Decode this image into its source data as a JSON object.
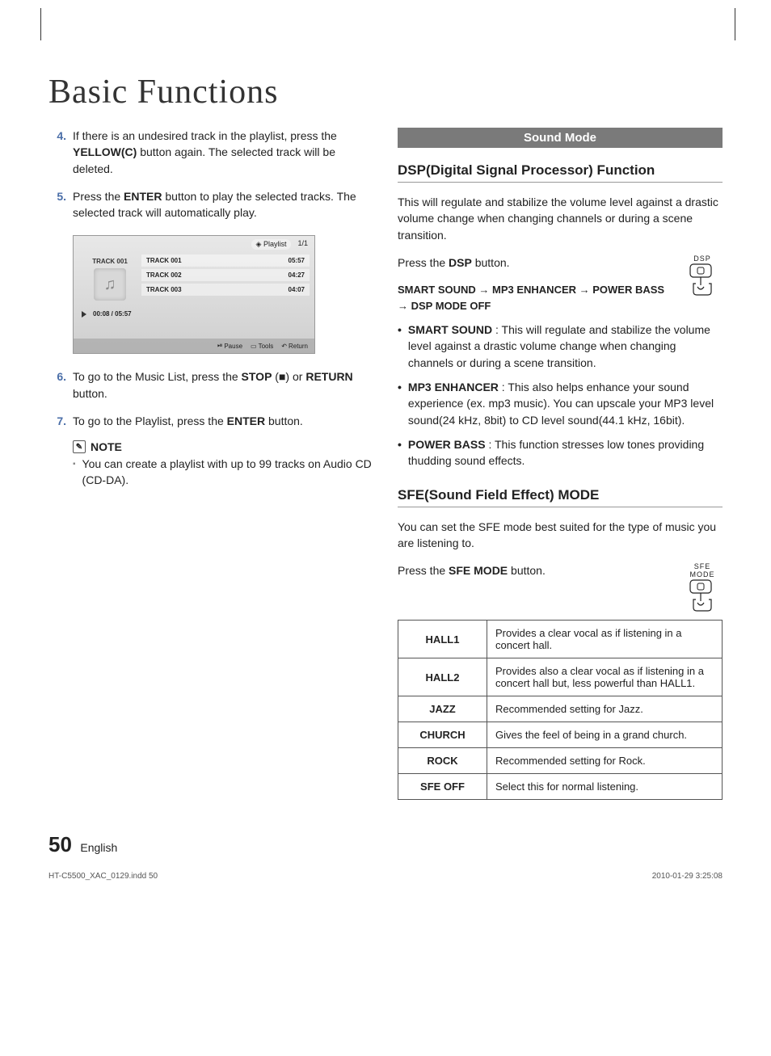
{
  "title": "Basic Functions",
  "steps": [
    {
      "n": "4.",
      "html": "If there is an undesired track in the playlist, press the <b>YELLOW(C)</b> button again. The selected track will be deleted."
    },
    {
      "n": "5.",
      "html": "Press the <b>ENTER</b> button to play the selected tracks. The selected track will automatically play."
    }
  ],
  "screenshot": {
    "headerLeft": "Playlist",
    "headerRight": "1/1",
    "currentCaption": "TRACK 001",
    "tracks": [
      {
        "name": "TRACK 001",
        "time": "05:57"
      },
      {
        "name": "TRACK 002",
        "time": "04:27"
      },
      {
        "name": "TRACK 003",
        "time": "04:07"
      }
    ],
    "progress": "00:08 / 05:57",
    "footer": {
      "pause": "Pause",
      "tools": "Tools",
      "return": "Return"
    }
  },
  "steps2": [
    {
      "n": "6.",
      "html": "To go to the Music List, press the <b>STOP</b> (■) or <b>RETURN</b> button."
    },
    {
      "n": "7.",
      "html": "To go to the Playlist, press the <b>ENTER</b> button."
    }
  ],
  "noteLabel": "NOTE",
  "noteItems": [
    "You can create a playlist with up to 99 tracks on Audio CD (CD-DA)."
  ],
  "soundMode": {
    "bar": "Sound Mode",
    "dspTitle": "DSP(Digital Signal Processor) Function",
    "dspIntro": "This will regulate and stabilize the volume level against a drastic volume change when changing channels or during a scene transition.",
    "pressDspPrefix": "Press the ",
    "pressDspBold": "DSP",
    "pressDspSuffix": " button.",
    "dspBtnLabel": "DSP",
    "flow": "SMART SOUND → MP3 ENHANCER → POWER BASS → DSP MODE OFF",
    "dspBullets": [
      {
        "b": "SMART SOUND",
        "t": " : This will regulate and stabilize the volume level against a drastic volume change when changing channels or during a scene transition."
      },
      {
        "b": "MP3 ENHANCER",
        "t": " : This also helps enhance your sound experience (ex. mp3 music). You can upscale your MP3 level sound(24 kHz, 8bit) to CD level sound(44.1 kHz, 16bit)."
      },
      {
        "b": "POWER BASS",
        "t": " : This function stresses low tones providing thudding sound effects."
      }
    ],
    "sfeTitle": "SFE(Sound Field Effect) MODE",
    "sfeIntro": "You can set the SFE mode best suited for the type of music you are listening to.",
    "pressSfePrefix": "Press the ",
    "pressSfeBold": "SFE MODE",
    "pressSfeSuffix": " button.",
    "sfeBtnLabel": "SFE MODE",
    "sfeTable": [
      {
        "k": "HALL1",
        "v": "Provides a clear vocal as if listening in a concert hall."
      },
      {
        "k": "HALL2",
        "v": "Provides also a clear vocal as if listening in a concert hall but, less powerful than HALL1."
      },
      {
        "k": "JAZZ",
        "v": "Recommended setting for Jazz."
      },
      {
        "k": "CHURCH",
        "v": "Gives the feel of being in a grand church."
      },
      {
        "k": "ROCK",
        "v": "Recommended setting for Rock."
      },
      {
        "k": "SFE OFF",
        "v": "Select this for normal listening."
      }
    ]
  },
  "pageNumber": "50",
  "pageLang": "English",
  "docFile": "HT-C5500_XAC_0129.indd   50",
  "docDate": "2010-01-29   3:25:08"
}
